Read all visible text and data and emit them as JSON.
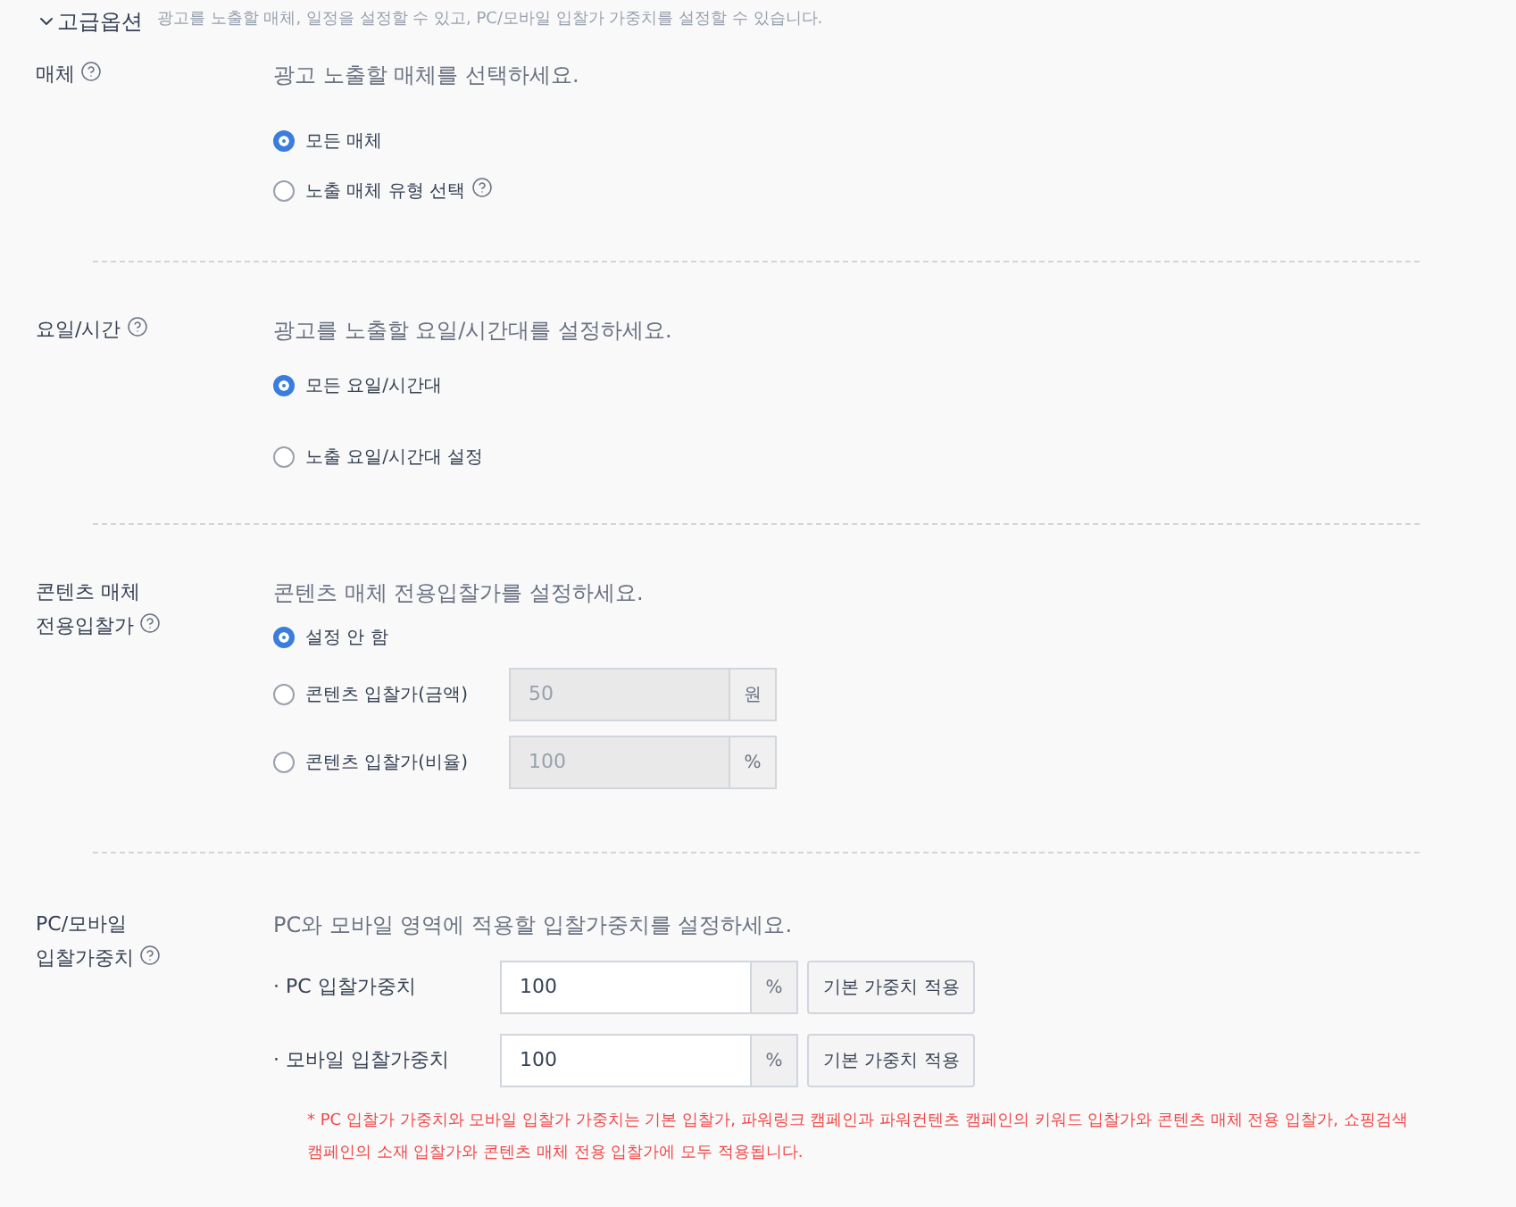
{
  "header": {
    "title": "고급옵션",
    "expanded": true,
    "description": "광고를 노출할 매체, 일정을 설정할 수 있고, PC/모바일 입찰가 가중치를 설정할 수 있습니다."
  },
  "sections": [
    {
      "kind": "radios",
      "label": [
        "매체"
      ],
      "help": true,
      "description": "광고 노출할 매체를 선택하세요.",
      "options": [
        {
          "label": "모든 매체",
          "selected": true
        },
        {
          "label": "노출 매체 유형 선택",
          "selected": false,
          "help": true
        }
      ]
    },
    {
      "kind": "radios",
      "label": [
        "요일/시간"
      ],
      "help": true,
      "description": "광고를 노출할 요일/시간대를 설정하세요.",
      "options": [
        {
          "label": "모든 요일/시간대",
          "selected": true
        },
        {
          "label": "노출 요일/시간대 설정",
          "selected": false
        }
      ]
    },
    {
      "kind": "radios",
      "label": [
        "콘텐츠 매체",
        "전용입찰가"
      ],
      "help": true,
      "description": "콘텐츠 매체 전용입찰가를 설정하세요.",
      "options": [
        {
          "label": "설정 안 함",
          "selected": true
        },
        {
          "label": "콘텐츠 입찰가(금액)",
          "selected": false,
          "input": {
            "value": "50",
            "unit": "원",
            "disabled": true
          }
        },
        {
          "label": "콘텐츠 입찰가(비율)",
          "selected": false,
          "input": {
            "value": "100",
            "unit": "%",
            "disabled": true
          }
        }
      ]
    },
    {
      "kind": "weights",
      "label": [
        "PC/모바일",
        "입찰가중치"
      ],
      "help": true,
      "description": "PC와 모바일 영역에 적용할 입찰가중치를 설정하세요.",
      "rows": [
        {
          "label": "· PC 입찰가중치",
          "value": "100",
          "unit": "%",
          "button": "기본 가중치 적용"
        },
        {
          "label": "· 모바일 입찰가중치",
          "value": "100",
          "unit": "%",
          "button": "기본 가중치 적용"
        }
      ],
      "note": "* PC 입찰가 가중치와 모바일 입찰가 가중치는 기본 입찰가, 파워링크 캠페인과 파워컨텐츠 캠페인의 키워드 입찰가와 콘텐츠 매체 전용 입찰가, 쇼핑검색 캠페인의 소재 입찰가와 콘텐츠 매체 전용 입찰가에 모두 적용됩니다."
    }
  ]
}
